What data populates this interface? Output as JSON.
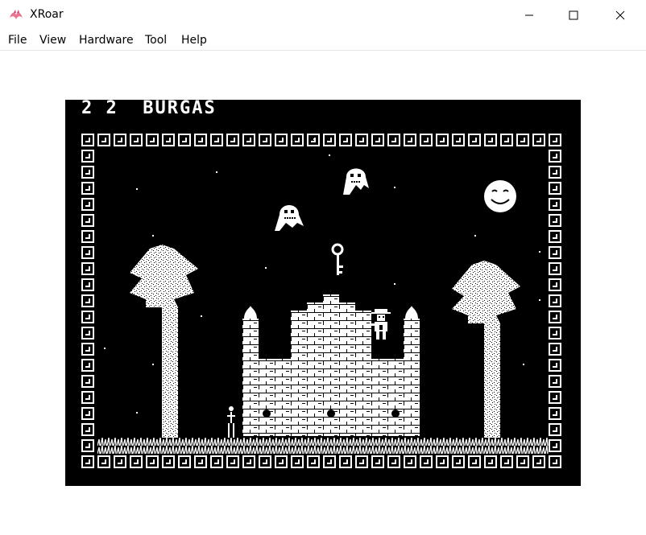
{
  "window": {
    "title": "XRoar",
    "controls": {
      "minimize": "─",
      "maximize": "☐",
      "close": "✕"
    }
  },
  "menu": [
    "File",
    "View",
    "Hardware",
    "Tool",
    "Help"
  ],
  "game": {
    "hud": "2 2  BURGAS"
  }
}
